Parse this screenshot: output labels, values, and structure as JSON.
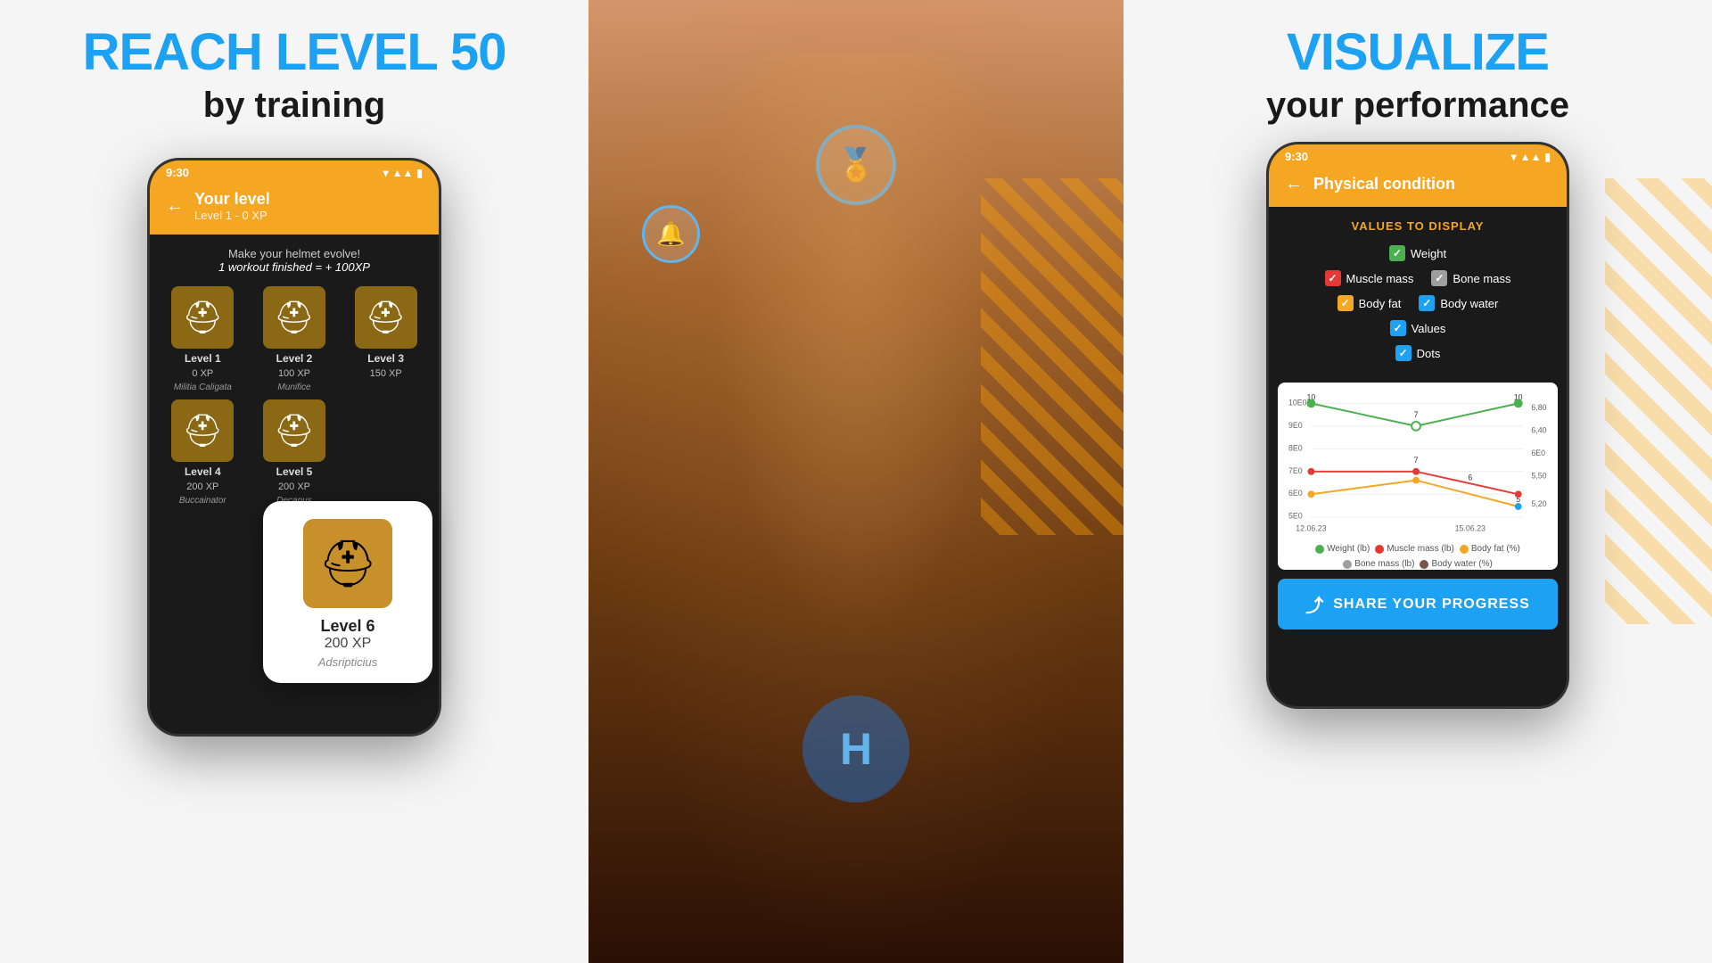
{
  "left": {
    "heading_blue": "REACH LEVEL 50",
    "heading_sub": "by training",
    "phone": {
      "status_time": "9:30",
      "header_title": "Your level",
      "header_subtitle": "Level 1 - 0 XP",
      "hint_line1": "Make your helmet evolve!",
      "hint_line2": "1 workout finished = + 100XP",
      "levels": [
        {
          "label": "Level 1",
          "xp": "0 XP",
          "name": "Militia Caligata"
        },
        {
          "label": "Level 2",
          "xp": "100 XP",
          "name": "Munifice"
        },
        {
          "label": "Level 3",
          "xp": "150 XP",
          "name": ""
        },
        {
          "label": "Level 4",
          "xp": "200 XP",
          "name": "Buccainator"
        },
        {
          "label": "Level 5",
          "xp": "200 XP",
          "name": "Decanus"
        },
        {
          "label": "Level 6",
          "xp": "200 XP",
          "name": "Adsripticius"
        }
      ],
      "popup_level": "Level 6",
      "popup_xp": "200 XP",
      "popup_name": "Adsripticius"
    }
  },
  "right": {
    "heading_blue": "VISUALIZE",
    "heading_sub": "your performance",
    "phone": {
      "status_time": "9:30",
      "header_title": "Physical condition",
      "values_title": "VALUES TO DISPLAY",
      "checkboxes": [
        {
          "label": "Weight",
          "color": "green",
          "checked": true
        },
        {
          "label": "Muscle mass",
          "color": "red",
          "checked": true
        },
        {
          "label": "Bone mass",
          "color": "gray",
          "checked": true
        },
        {
          "label": "Body fat",
          "color": "orange",
          "checked": true
        },
        {
          "label": "Body water",
          "color": "blue",
          "checked": true
        },
        {
          "label": "Values",
          "color": "blue",
          "checked": true
        },
        {
          "label": "Dots",
          "color": "blue",
          "checked": true
        }
      ],
      "chart": {
        "x_labels": [
          "12.06.23",
          "15.06.23"
        ],
        "left_y": [
          "10E0",
          "9E0",
          "8E0",
          "7E0",
          "6E0",
          "5E0"
        ],
        "right_y": [
          "6,80",
          "6,40",
          "6E0",
          "5,50",
          "5,20"
        ],
        "top_values": [
          "10",
          "7",
          "10"
        ],
        "data_points": {
          "weight": [
            10,
            7,
            10
          ],
          "muscle_mass": [
            7,
            6,
            5
          ],
          "bone_mass": []
        }
      },
      "legend": [
        {
          "label": "Weight (lb)",
          "color": "#4caf50"
        },
        {
          "label": "Muscle mass (lb)",
          "color": "#e53935"
        },
        {
          "label": "Body fat (%)",
          "color": "#f5a623"
        },
        {
          "label": "Bone mass (lb)",
          "color": "#9e9e9e"
        },
        {
          "label": "Body water (%)",
          "color": "#795548"
        }
      ],
      "share_button": "SHARE YOUR PROGRESS"
    }
  }
}
